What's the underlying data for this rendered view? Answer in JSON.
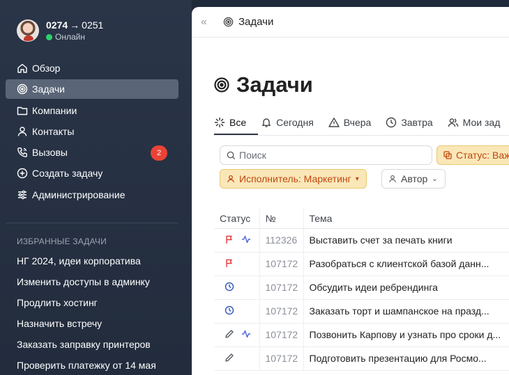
{
  "user": {
    "from": "0274",
    "arrow": "→",
    "to": "0251",
    "status": "Онлайн",
    "status_color": "#2fd06b"
  },
  "nav": [
    {
      "label": "Обзор",
      "icon": "home-icon"
    },
    {
      "label": "Задачи",
      "icon": "target-icon",
      "active": true
    },
    {
      "label": "Компании",
      "icon": "folder-icon"
    },
    {
      "label": "Контакты",
      "icon": "user-icon"
    },
    {
      "label": "Вызовы",
      "icon": "phone-icon",
      "badge": "2"
    },
    {
      "label": "Создать задачу",
      "icon": "plus-circle-icon"
    },
    {
      "label": "Администрирование",
      "icon": "sliders-icon"
    }
  ],
  "favorites": {
    "title": "ИЗБРАННЫЕ ЗАДАЧИ",
    "items": [
      "НГ 2024, идеи корпоратива",
      "Изменить доступы в админку",
      "Продлить хостинг",
      "Назначить встречу",
      "Заказать заправку принтеров",
      "Проверить платежку от 14 мая"
    ]
  },
  "topbar": {
    "collapse": "«",
    "title": "Задачи"
  },
  "page": {
    "title": "Задачи"
  },
  "tabs": [
    {
      "label": "Все",
      "icon": "loader-icon",
      "active": true
    },
    {
      "label": "Сегодня",
      "icon": "bell-icon"
    },
    {
      "label": "Вчера",
      "icon": "warning-icon"
    },
    {
      "label": "Завтра",
      "icon": "clock-icon"
    },
    {
      "label": "Мои зад",
      "icon": "users-icon"
    }
  ],
  "search": {
    "placeholder": "Поиск"
  },
  "filters": {
    "status": "Статус: Важ",
    "assignee": "Исполнитель: Маркетинг",
    "author": "Автор"
  },
  "table": {
    "headers": [
      "Статус",
      "№",
      "Тема"
    ],
    "rows": [
      {
        "icons": [
          "flag-icon",
          "activity-icon"
        ],
        "num": "112326",
        "topic": "Выставить счет за печать книги"
      },
      {
        "icons": [
          "flag-icon"
        ],
        "num": "107172",
        "topic": "Разобраться с клиентской базой данн..."
      },
      {
        "icons": [
          "clock-icon"
        ],
        "num": "107172",
        "topic": "Обсудить идеи ребрендинга"
      },
      {
        "icons": [
          "clock-icon"
        ],
        "num": "107172",
        "topic": "Заказать торт и шампанское на празд..."
      },
      {
        "icons": [
          "pencil-icon",
          "activity-icon"
        ],
        "num": "107172",
        "topic": "Позвонить Карпову и узнать про сроки д..."
      },
      {
        "icons": [
          "pencil-icon"
        ],
        "num": "107172",
        "topic": "Подготовить презентацию для Росмо..."
      }
    ]
  },
  "colors": {
    "flag": "#e23b3b",
    "clock": "#3d5bbf",
    "activity": "#4a63d8",
    "pencil": "#555b63",
    "badge": "#ea4335",
    "chip": "#fae7b8"
  }
}
